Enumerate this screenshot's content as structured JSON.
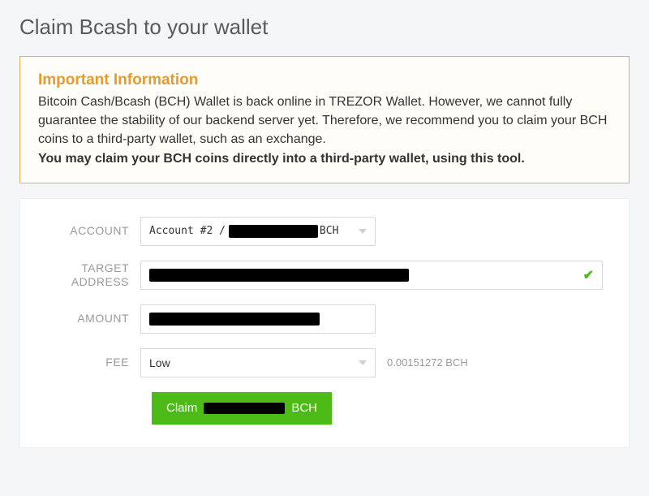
{
  "page": {
    "title": "Claim Bcash to your wallet"
  },
  "notice": {
    "title": "Important Information",
    "body_1": "Bitcoin Cash/Bcash (BCH) Wallet is back online in TREZOR Wallet. However, we cannot fully guarantee the stability of our backend server yet. Therefore, we recommend you to claim your BCH coins to a third-party wallet, such as an exchange.",
    "body_bold": "You may claim your BCH coins directly into a third-party wallet, using this tool."
  },
  "form": {
    "account": {
      "label": "ACCOUNT",
      "prefix": "Account #2 /",
      "suffix": "BCH"
    },
    "target": {
      "label": "TARGET ADDRESS"
    },
    "amount": {
      "label": "AMOUNT"
    },
    "fee": {
      "label": "FEE",
      "selected": "Low",
      "display": "0.00151272 BCH"
    },
    "button": {
      "prefix": "Claim",
      "suffix": "BCH"
    }
  }
}
